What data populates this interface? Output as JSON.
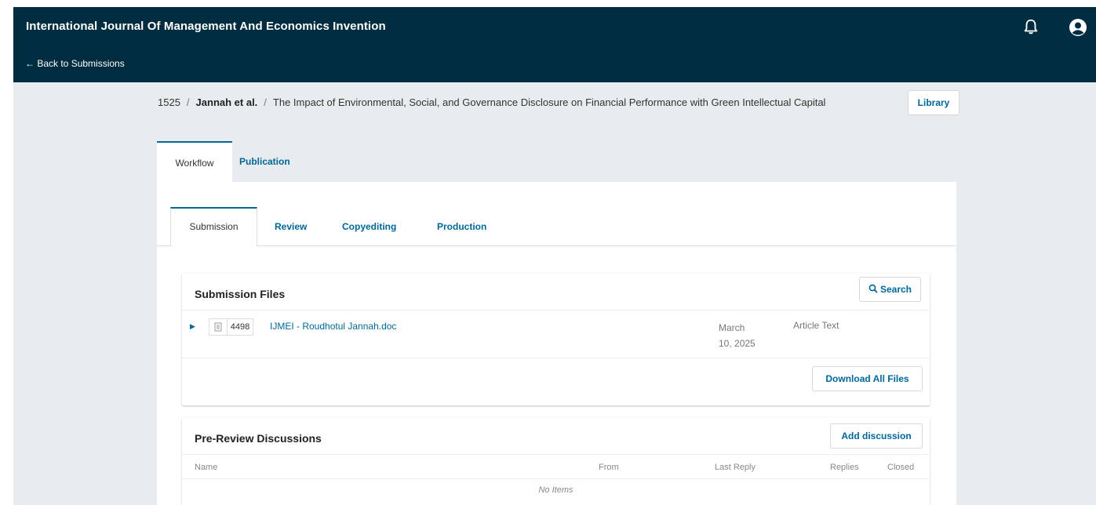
{
  "header": {
    "journal_title": "International Journal Of Management And Economics Invention",
    "back_link": "← Back to Submissions"
  },
  "breadcrumb": {
    "id": "1525",
    "authors": "Jannah et al.",
    "title": "The Impact of Environmental, Social, and Governance Disclosure on Financial Performance with Green Intellectual Capital",
    "separator": "/"
  },
  "library_label": "Library",
  "main_tabs": {
    "workflow": "Workflow",
    "publication": "Publication"
  },
  "stage_tabs": {
    "submission": "Submission",
    "review": "Review",
    "copyediting": "Copyediting",
    "production": "Production"
  },
  "submission_files": {
    "title": "Submission Files",
    "search_label": "Search",
    "file": {
      "id": "4498",
      "name": "IJMEI - Roudhotul Jannah.doc",
      "date_line1": "March",
      "date_line2": "10, 2025",
      "type": "Article Text"
    },
    "download_all_label": "Download All Files"
  },
  "discussions": {
    "title": "Pre-Review Discussions",
    "add_label": "Add discussion",
    "columns": {
      "name": "Name",
      "from": "From",
      "last_reply": "Last Reply",
      "replies": "Replies",
      "closed": "Closed"
    },
    "empty": "No Items"
  },
  "colors": {
    "header_bg": "#002c40",
    "accent": "#006798",
    "page_bg": "#e9ecee"
  }
}
